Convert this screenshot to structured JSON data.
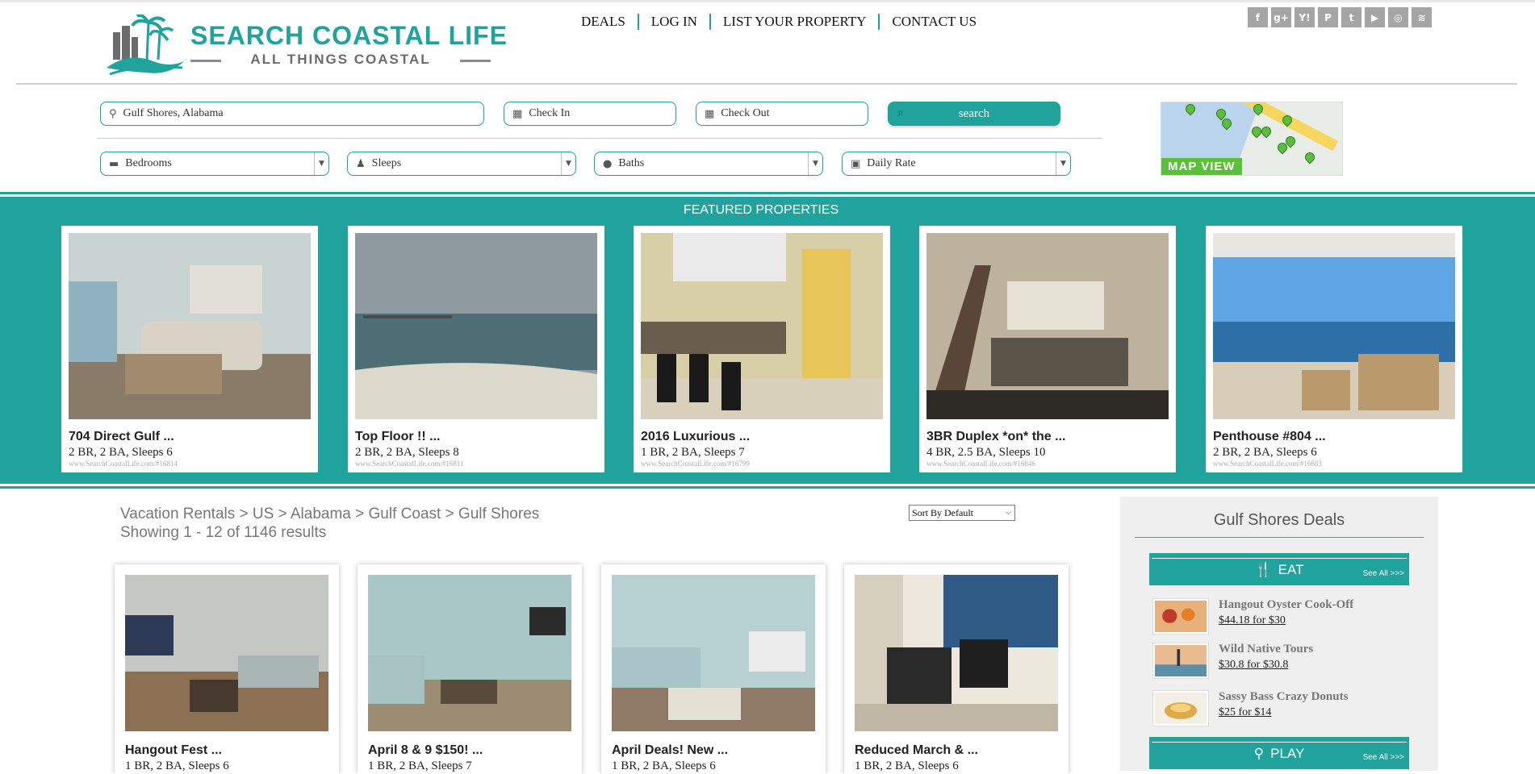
{
  "header": {
    "logo_title": "SEARCH COASTAL LIFE",
    "logo_subtitle": "ALL THINGS COASTAL",
    "nav": [
      "DEALS",
      "LOG IN",
      "LIST YOUR PROPERTY",
      "CONTACT US"
    ],
    "social": [
      "f",
      "g+",
      "Y!",
      "P",
      "t",
      "▶",
      "◎",
      "≋"
    ]
  },
  "search": {
    "location": "Gulf Shores, Alabama",
    "check_in": "Check In",
    "check_out": "Check Out",
    "button": "search",
    "bedrooms": "Bedrooms",
    "sleeps": "Sleeps",
    "baths": "Baths",
    "daily_rate": "Daily Rate",
    "map_label": "MAP VIEW"
  },
  "featured": {
    "title": "FEATURED PROPERTIES",
    "items": [
      {
        "title": "704 Direct Gulf ...",
        "meta": "2 BR, 2 BA, Sleeps 6",
        "id": "www.SearchCoastalLife.com/#16814"
      },
      {
        "title": "Top Floor !! ...",
        "meta": "2 BR, 2 BA, Sleeps 8",
        "id": "www.SearchCoastalLife.com/#16811"
      },
      {
        "title": "2016 Luxurious ...",
        "meta": "1 BR, 2 BA, Sleeps 7",
        "id": "www.SearchCoastalLife.com/#16799"
      },
      {
        "title": "3BR Duplex *on* the ...",
        "meta": "4 BR, 2.5 BA, Sleeps 10",
        "id": "www.SearchCoastalLife.com/#16846"
      },
      {
        "title": "Penthouse #804 ...",
        "meta": "2 BR, 2 BA, Sleeps 6",
        "id": "www.SearchCoastalLife.com/#16683"
      }
    ]
  },
  "results": {
    "breadcrumb": "Vacation Rentals > US > Alabama > Gulf Coast > Gulf Shores",
    "count": "Showing 1 - 12 of 1146 results",
    "sort": "Sort By Default",
    "items": [
      {
        "title": "Hangout Fest ...",
        "meta": "1 BR, 2 BA, Sleeps 6"
      },
      {
        "title": "April 8 & 9 $150! ...",
        "meta": "1 BR, 2 BA, Sleeps 7"
      },
      {
        "title": "April Deals! New ...",
        "meta": "1 BR, 2 BA, Sleeps 6"
      },
      {
        "title": "Reduced March & ...",
        "meta": "1 BR, 2 BA, Sleeps 6"
      }
    ]
  },
  "sidebar": {
    "title": "Gulf Shores Deals",
    "eat_label": "EAT",
    "play_label": "PLAY",
    "see_all": "See All >>>",
    "deals": [
      {
        "name": "Hangout Oyster Cook-Off",
        "price": "$44.18 for $30"
      },
      {
        "name": "Wild Native Tours",
        "price": "$30.8 for $30.8"
      },
      {
        "name": "Sassy Bass Crazy Donuts",
        "price": "$25 for $14"
      }
    ]
  },
  "colors": {
    "accent": "#1fa39c",
    "map_pin": "#5bbf3e"
  }
}
